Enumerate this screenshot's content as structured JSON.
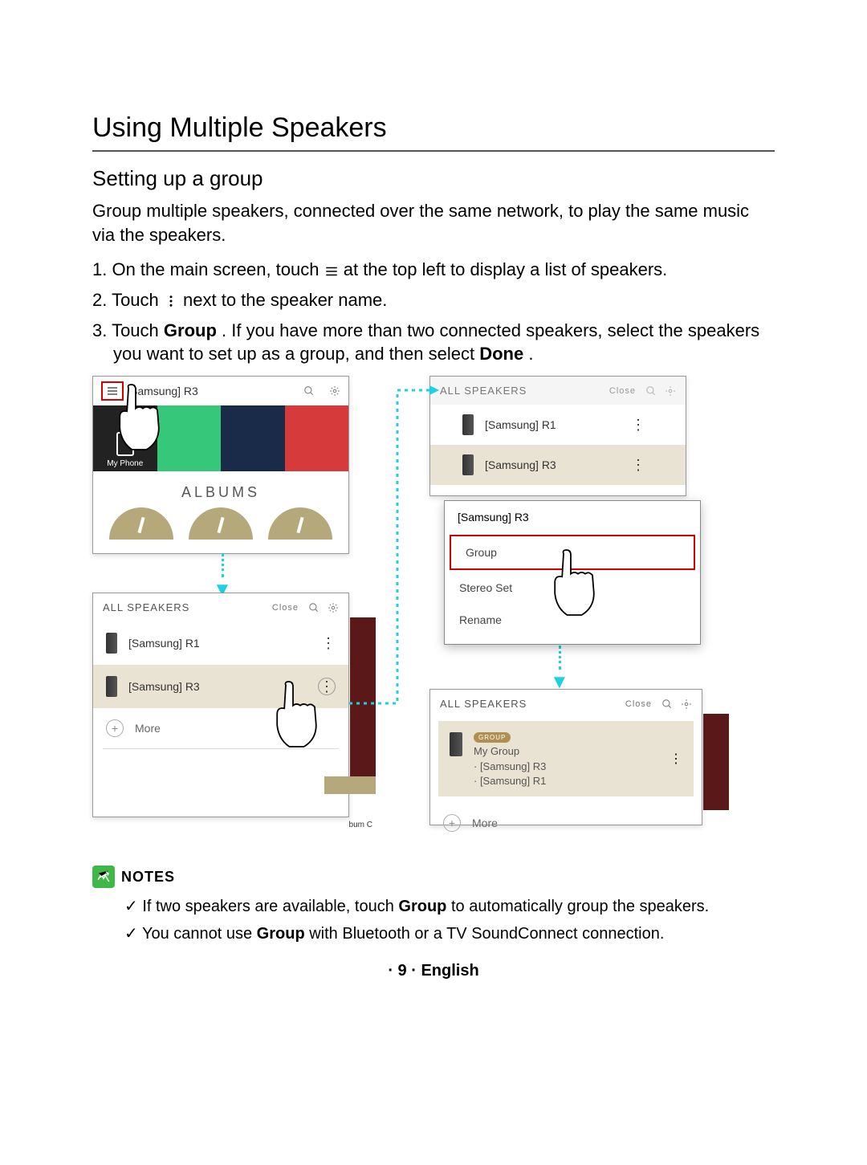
{
  "title": "Using Multiple Speakers",
  "subtitle": "Setting up a group",
  "intro": "Group multiple speakers, connected over the same network, to play the same music via the speakers.",
  "steps": {
    "s1_a": "On the main screen, touch ",
    "s1_b": " at the top left to display a list of speakers.",
    "s2_a": "Touch ",
    "s2_b": " next to the speaker name.",
    "s3_a": "Touch ",
    "s3_group": "Group",
    "s3_b": ". If you have more than two connected speakers, select the speakers you want to set up as a group, and then select ",
    "s3_done": "Done",
    "s3_c": "."
  },
  "panel1": {
    "speaker": "Samsung] R3",
    "myphone": "My Phone",
    "albums": "ALBUMS"
  },
  "panel2": {
    "header": "ALL SPEAKERS",
    "close": "Close",
    "spk1": "[Samsung] R1",
    "spk2": "[Samsung] R3",
    "more": "More",
    "side": "bum C"
  },
  "panel3bg": {
    "header": "ALL SPEAKERS",
    "close": "Close",
    "spk1": "[Samsung] R1",
    "spk2": "[Samsung] R3"
  },
  "panel3": {
    "title": "[Samsung] R3",
    "opt1": "Group",
    "opt2": "Stereo Set",
    "opt3": "Rename"
  },
  "panel4": {
    "header": "ALL SPEAKERS",
    "close": "Close",
    "badge": "GROUP",
    "name": "My Group",
    "m1": "· [Samsung] R3",
    "m2": "· [Samsung] R1",
    "more": "More"
  },
  "notes": {
    "label": "NOTES",
    "n1_a": "If two speakers are available, touch ",
    "n1_b": "Group",
    "n1_c": " to automatically group the speakers.",
    "n2_a": "You cannot use ",
    "n2_b": "Group",
    "n2_c": " with Bluetooth or a TV SoundConnect connection."
  },
  "footer": {
    "page": "9",
    "lang": "English"
  }
}
